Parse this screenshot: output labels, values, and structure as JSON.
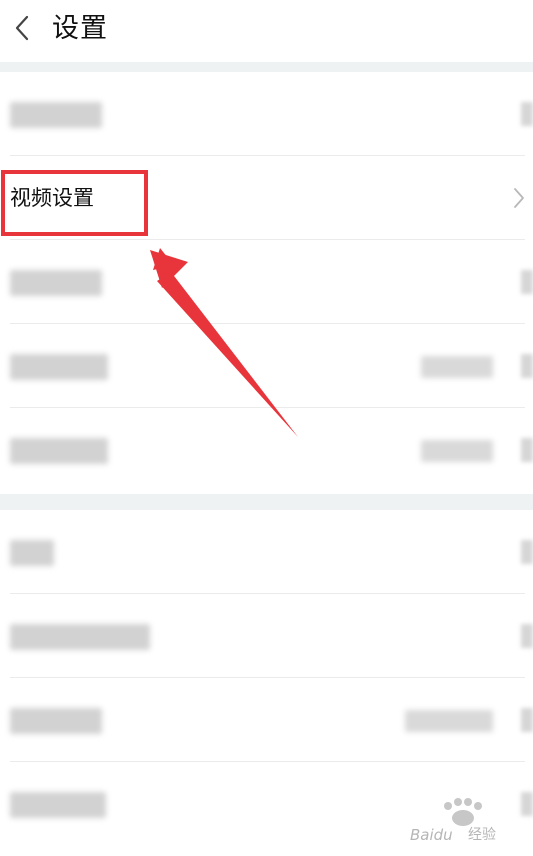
{
  "header": {
    "title": "设置",
    "back_icon": "chevron-left-icon"
  },
  "highlighted_row": {
    "label": "视频设置"
  },
  "watermark": {
    "brand": "Baidu",
    "text": "经验"
  },
  "colors": {
    "highlight": "#e8353b",
    "section_gap": "#eef2f2",
    "divider": "#ebebeb"
  }
}
